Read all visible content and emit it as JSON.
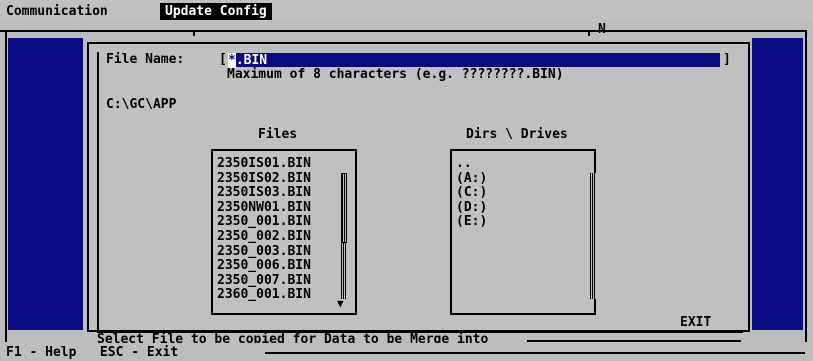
{
  "menu": {
    "items": [
      {
        "label": "Communication"
      },
      {
        "label": "Update Config"
      }
    ]
  },
  "frame": {
    "corner_label": "N"
  },
  "dialog": {
    "file_name_label": "File Name:",
    "file_name_open_bracket": "[",
    "file_name_close_bracket": "]",
    "file_name_value": "*.BIN",
    "hint": "Maximum of 8 characters (e.g. ????????.BIN)",
    "current_path": "C:\\GC\\APP",
    "files_header": "Files",
    "dirs_header": "Dirs \\ Drives",
    "files": [
      "2350IS01.BIN",
      "2350IS02.BIN",
      "2350IS03.BIN",
      "2350NW01.BIN",
      "2350_001.BIN",
      "2350_002.BIN",
      "2350_003.BIN",
      "2350_006.BIN",
      "2350_007.BIN",
      "2360_001.BIN"
    ],
    "dirs": [
      "..",
      "(A:)",
      "(C:)",
      "(D:)",
      "(E:)"
    ],
    "exit_label": "EXIT",
    "scroll_down_arrow": "▼",
    "status_message": "Select File to be copied for Data to be Merge into"
  },
  "footer": {
    "text": "F1 - Help   ESC - Exit"
  },
  "colors": {
    "background": "#c0c0c0",
    "panel": "#0a0a80",
    "text": "#000000",
    "highlight_text": "#ffffff"
  }
}
